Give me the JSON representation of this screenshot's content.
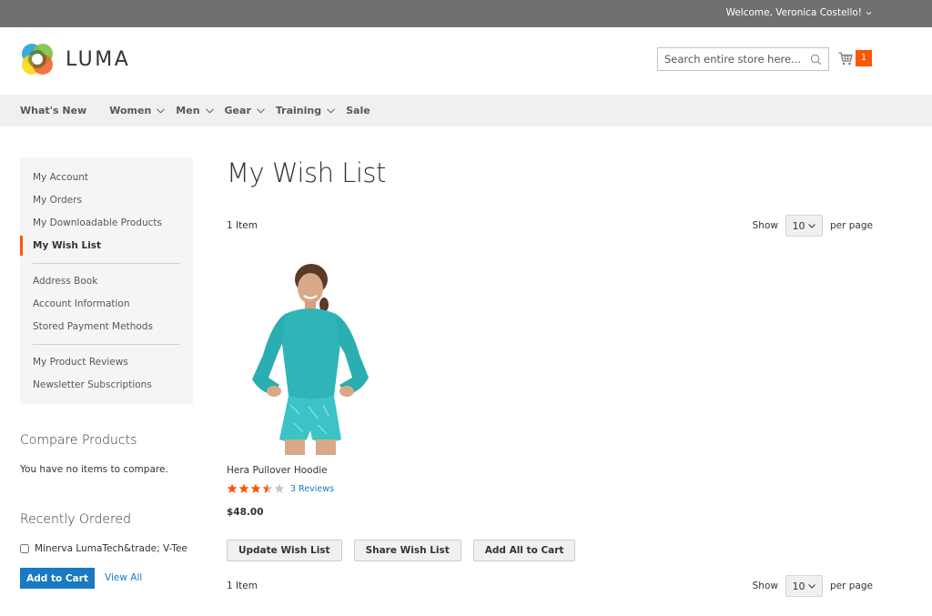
{
  "topbar": {
    "welcome": "Welcome, Veronica Costello!"
  },
  "header": {
    "logo_text": "LUMA",
    "search_placeholder": "Search entire store here...",
    "cart_count": "1",
    "colors": {
      "accent": "#ff5501",
      "link": "#1979c3",
      "topbar": "#6e716e"
    }
  },
  "nav": {
    "items": [
      {
        "label": "What's New",
        "has_dropdown": false
      },
      {
        "label": "Women",
        "has_dropdown": true
      },
      {
        "label": "Men",
        "has_dropdown": true
      },
      {
        "label": "Gear",
        "has_dropdown": true
      },
      {
        "label": "Training",
        "has_dropdown": true
      },
      {
        "label": "Sale",
        "has_dropdown": false
      }
    ]
  },
  "sidebar": {
    "account_nav": [
      {
        "label": "My Account"
      },
      {
        "label": "My Orders"
      },
      {
        "label": "My Downloadable Products"
      },
      {
        "label": "My Wish List",
        "current": true
      },
      {
        "label": "Address Book"
      },
      {
        "label": "Account Information"
      },
      {
        "label": "Stored Payment Methods"
      },
      {
        "label": "My Product Reviews"
      },
      {
        "label": "Newsletter Subscriptions"
      }
    ],
    "compare": {
      "title": "Compare Products",
      "empty_text": "You have no items to compare."
    },
    "recently_ordered": {
      "title": "Recently Ordered",
      "items": [
        {
          "label": "Minerva LumaTech&trade; V-Tee",
          "checked": false
        }
      ],
      "add_to_cart_label": "Add to Cart",
      "view_all_label": "View All"
    }
  },
  "main": {
    "title": "My Wish List",
    "toolbar": {
      "amount": "1 Item",
      "show_label": "Show",
      "limit_value": "10",
      "per_page_label": "per page"
    },
    "products": [
      {
        "name": "Hera Pullover Hoodie",
        "image_alt": "Hera Pullover Hoodie",
        "rating_stars": 3.5,
        "rating_max": 5,
        "reviews_label": "3  Reviews",
        "price": "$48.00"
      }
    ],
    "actions": {
      "update": "Update Wish List",
      "share": "Share Wish List",
      "add_all": "Add All to Cart"
    }
  }
}
